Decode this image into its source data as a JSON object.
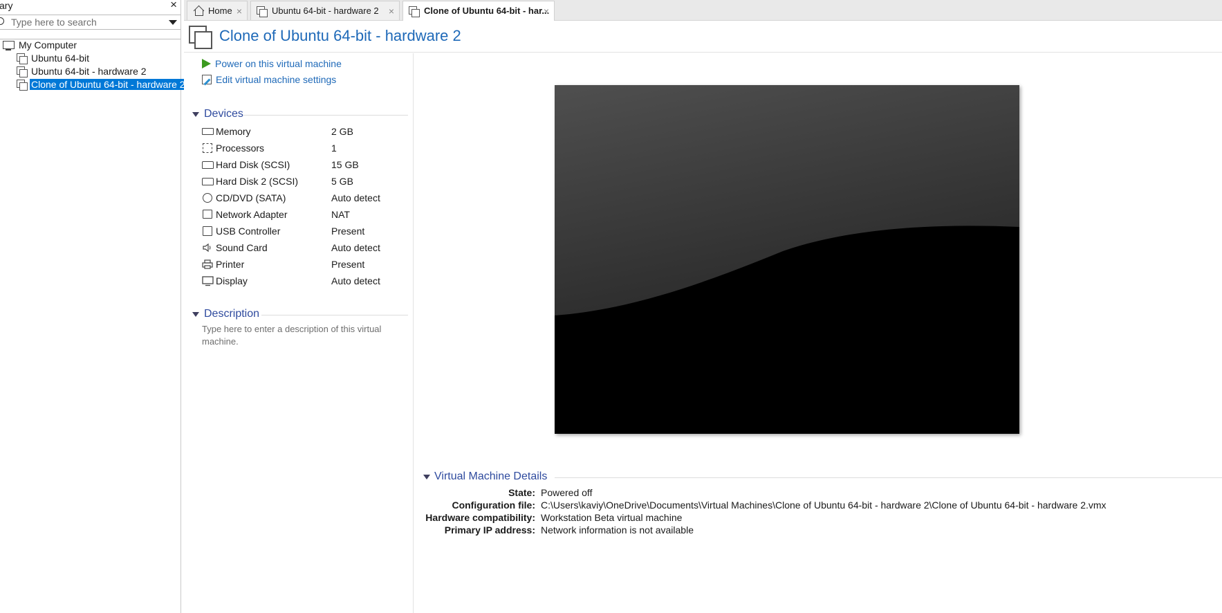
{
  "library": {
    "title": "ary",
    "close_label": "×",
    "search_placeholder": "Type here to search",
    "tree": [
      {
        "label": "My Computer",
        "type": "computer"
      },
      {
        "label": "Ubuntu 64-bit",
        "type": "vm"
      },
      {
        "label": "Ubuntu 64-bit - hardware 2",
        "type": "vm"
      },
      {
        "label": "Clone of Ubuntu 64-bit - hardware 2",
        "type": "vm",
        "selected": true
      }
    ]
  },
  "tabs": [
    {
      "label": "Home",
      "icon": "home-icon",
      "close": "×"
    },
    {
      "label": "Ubuntu 64-bit - hardware 2",
      "icon": "vm-icon",
      "close": "×"
    },
    {
      "label": "Clone of Ubuntu 64-bit - har...",
      "icon": "vm-icon",
      "close": "×",
      "active": true
    }
  ],
  "vm": {
    "title": "Clone of Ubuntu 64-bit - hardware 2",
    "actions": {
      "power_on": "Power on this virtual machine",
      "edit_settings": "Edit virtual machine settings"
    },
    "devices_heading": "Devices",
    "devices": [
      {
        "name": "Memory",
        "value": "2 GB",
        "icon": "memory-icon"
      },
      {
        "name": "Processors",
        "value": "1",
        "icon": "processor-icon"
      },
      {
        "name": "Hard Disk (SCSI)",
        "value": "15 GB",
        "icon": "hard-disk-icon"
      },
      {
        "name": "Hard Disk 2 (SCSI)",
        "value": "5 GB",
        "icon": "hard-disk-icon"
      },
      {
        "name": "CD/DVD (SATA)",
        "value": "Auto detect",
        "icon": "cd-dvd-icon"
      },
      {
        "name": "Network Adapter",
        "value": "NAT",
        "icon": "network-adapter-icon"
      },
      {
        "name": "USB Controller",
        "value": "Present",
        "icon": "usb-icon"
      },
      {
        "name": "Sound Card",
        "value": "Auto detect",
        "icon": "speaker-icon"
      },
      {
        "name": "Printer",
        "value": "Present",
        "icon": "printer-icon"
      },
      {
        "name": "Display",
        "value": "Auto detect",
        "icon": "monitor-icon"
      }
    ],
    "description_heading": "Description",
    "description_placeholder": "Type here to enter a description of this virtual machine.",
    "details_heading": "Virtual Machine Details",
    "details": [
      {
        "key": "State:",
        "value": "Powered off"
      },
      {
        "key": "Configuration file:",
        "value": "C:\\Users\\kaviy\\OneDrive\\Documents\\Virtual Machines\\Clone of Ubuntu 64-bit - hardware 2\\Clone of Ubuntu 64-bit - hardware 2.vmx"
      },
      {
        "key": "Hardware compatibility:",
        "value": "Workstation Beta virtual machine"
      },
      {
        "key": "Primary IP address:",
        "value": "Network information is not available"
      }
    ]
  },
  "colors": {
    "accent": "#1e69b8",
    "section": "#2e4a9e",
    "selection": "#0078d7",
    "play": "#3c9a1f"
  }
}
